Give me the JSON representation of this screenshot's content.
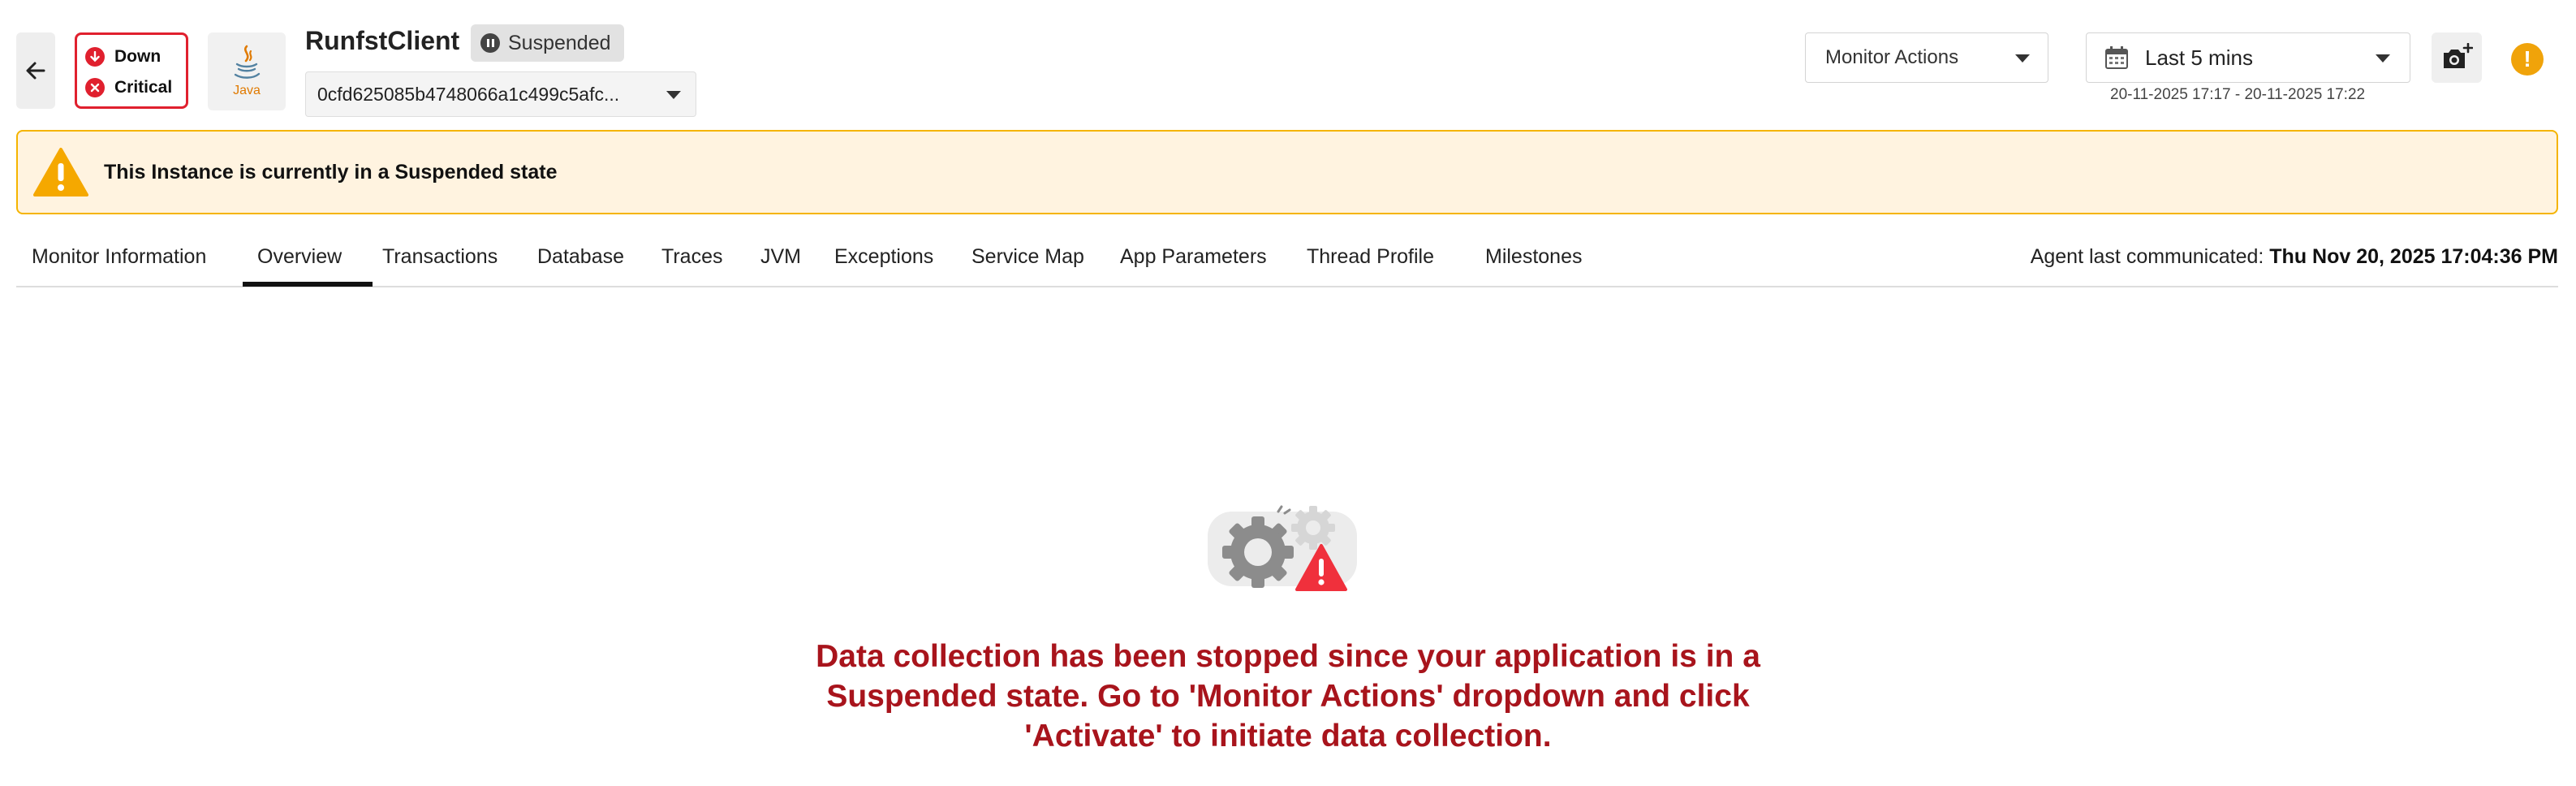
{
  "header": {
    "back_icon": "arrow-left-icon",
    "status": [
      {
        "label": "Down",
        "icon": "arrow-down-circle-icon",
        "color": "#e0202e"
      },
      {
        "label": "Critical",
        "icon": "x-circle-icon",
        "color": "#e0202e"
      }
    ],
    "logo": {
      "icon": "java-logo-icon",
      "text": "Java"
    },
    "monitor_name": "RunfstClient",
    "state_chip": "Suspended",
    "instance_value": "0cfd625085b4748066a1c499c5afc...",
    "monitor_actions_label": "Monitor Actions",
    "time_range": {
      "label": "Last 5 mins",
      "span": "20-11-2025 17:17 - 20-11-2025 17:22"
    },
    "camera_icon": "camera-add-icon",
    "alert_icon": "exclamation-circle-icon"
  },
  "banner": {
    "icon": "warning-triangle-icon",
    "text": "This Instance is currently in a Suspended state"
  },
  "tabs": [
    {
      "label": "Monitor Information"
    },
    {
      "label": "Overview"
    },
    {
      "label": "Transactions"
    },
    {
      "label": "Database"
    },
    {
      "label": "Traces"
    },
    {
      "label": "JVM"
    },
    {
      "label": "Exceptions"
    },
    {
      "label": "Service Map"
    },
    {
      "label": "App Parameters"
    },
    {
      "label": "Thread Profile"
    },
    {
      "label": "Milestones"
    }
  ],
  "active_tab": "Overview",
  "agent": {
    "label": "Agent last communicated: ",
    "value": "Thu Nov 20, 2025 17:04:36 PM"
  },
  "empty_state": {
    "icon": "gears-warning-icon",
    "message": "Data collection has been stopped since your application is in a Suspended state. Go to 'Monitor Actions' dropdown and click 'Activate' to initiate data collection."
  },
  "colors": {
    "critical": "#e0202e",
    "warning_border": "#f5b400",
    "warning_bg": "#fff3e0",
    "message": "#a8141c",
    "alert": "#f0a30a"
  }
}
